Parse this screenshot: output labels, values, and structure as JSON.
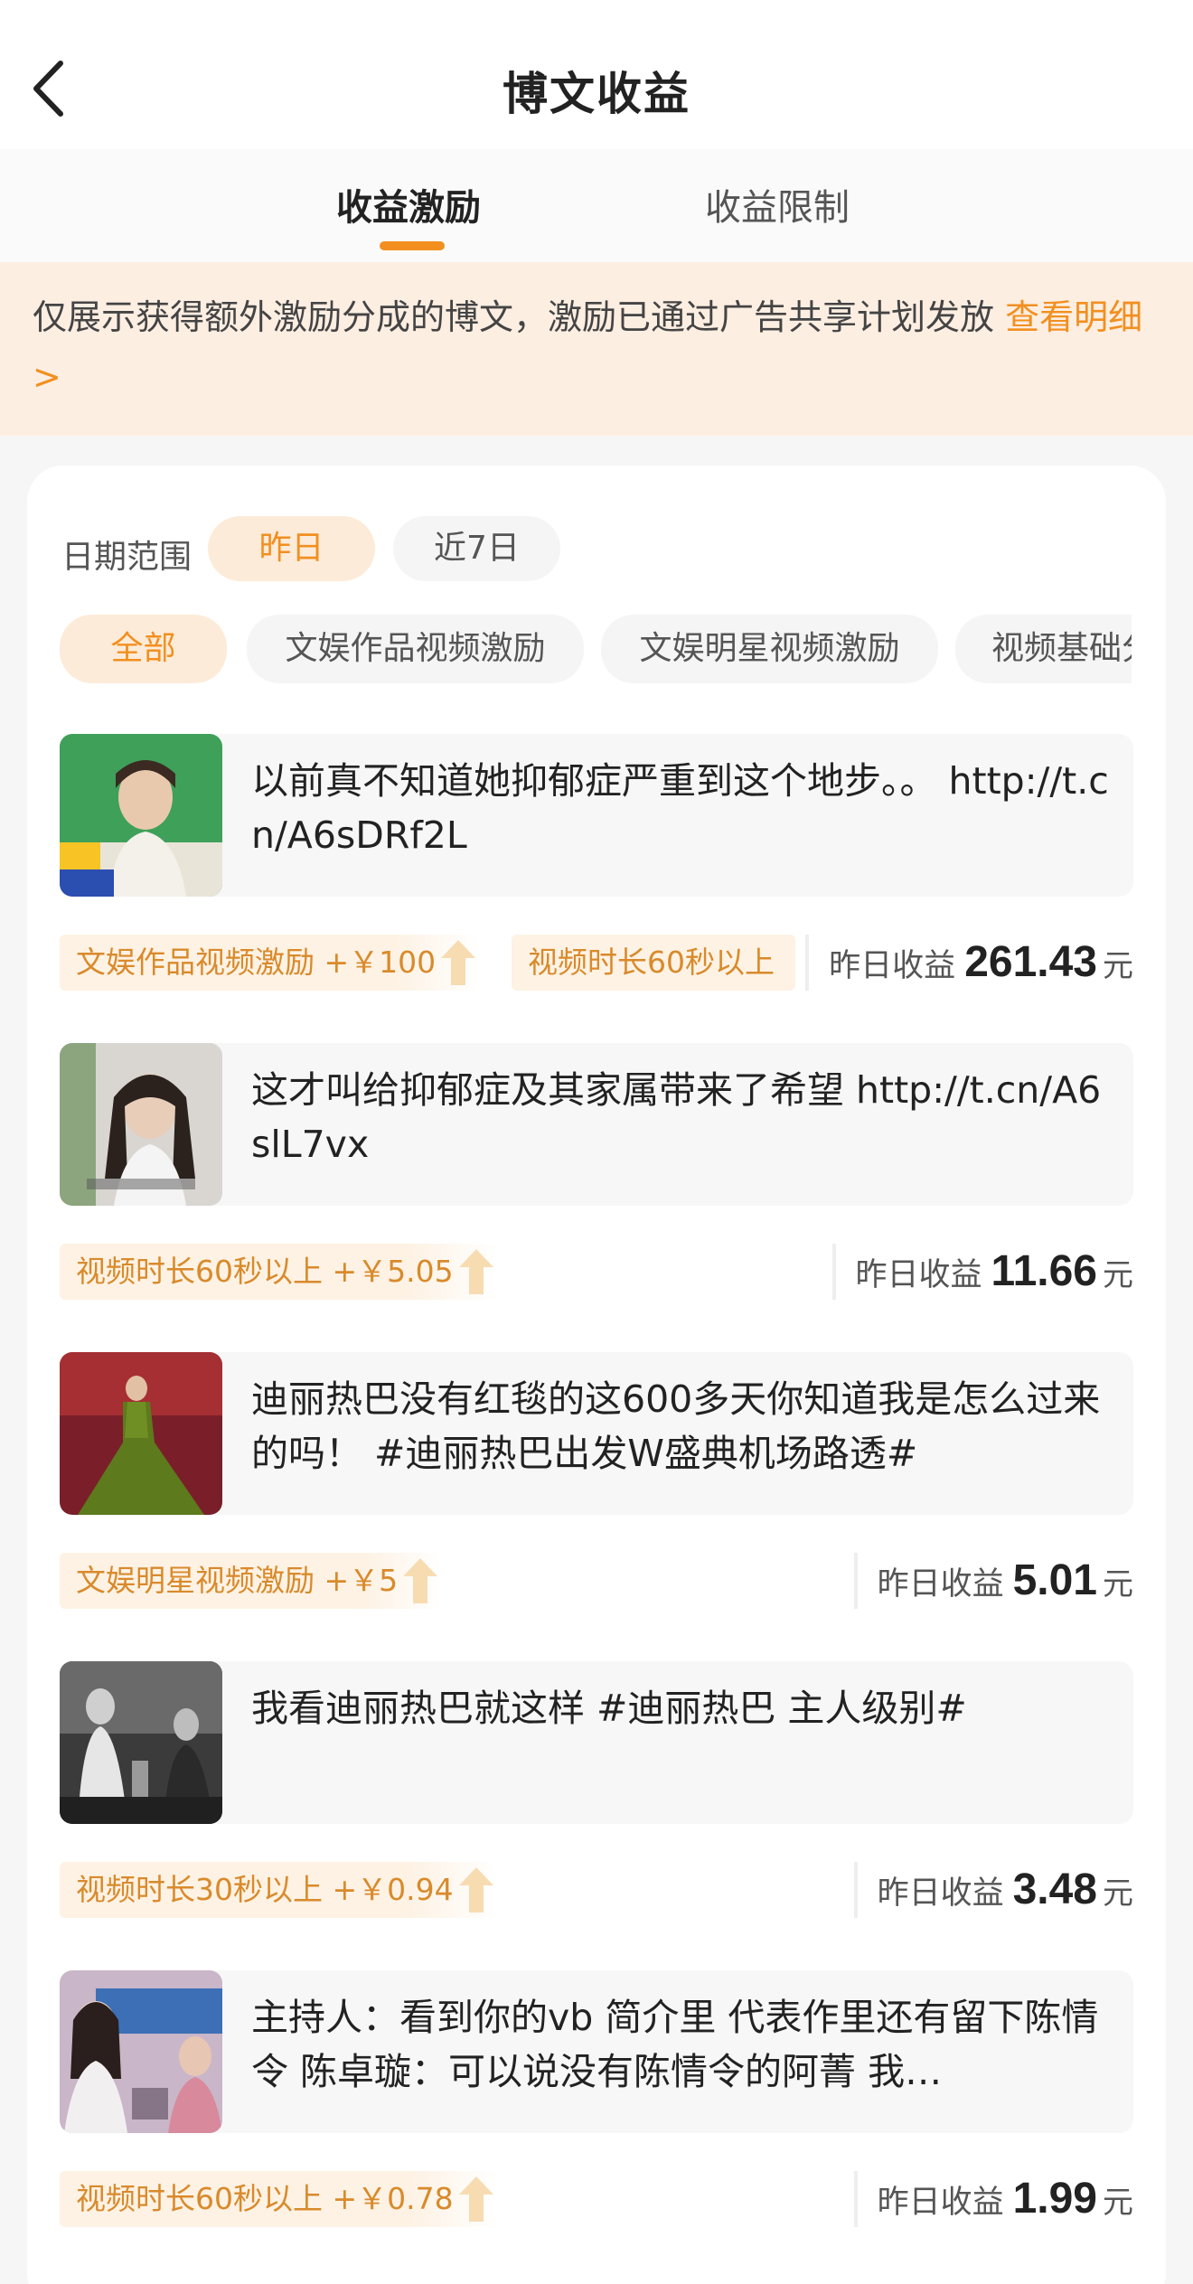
{
  "header": {
    "title": "博文收益"
  },
  "tabs": [
    {
      "label": "收益激励",
      "active": true
    },
    {
      "label": "收益限制",
      "active": false
    }
  ],
  "notice": {
    "text": "仅展示获得额外激励分成的博文，激励已通过广告共享计划发放 ",
    "link": "查看明细>"
  },
  "filters": {
    "date_label": "日期范围",
    "date_options": [
      "昨日",
      "近7日"
    ],
    "categories": [
      "全部",
      "文娱作品视频激励",
      "文娱明星视频激励",
      "视频基础分"
    ]
  },
  "earnings_label": "昨日收益",
  "unit": "元",
  "posts": [
    {
      "text": "以前真不知道她抑郁症严重到这个地步。。 http://t.cn/A6sDRf2L",
      "tags": [
        "文娱作品视频激励 +￥100",
        "视频时长60秒以上"
      ],
      "earnings": "261.43"
    },
    {
      "text": "这才叫给抑郁症及其家属带来了希望 http://t.cn/A6slL7vx",
      "tags": [
        "视频时长60秒以上 +￥5.05"
      ],
      "earnings": "11.66"
    },
    {
      "text": "迪丽热巴没有红毯的这600多天你知道我是怎么过来的吗！ #迪丽热巴出发W盛典机场路透#",
      "tags": [
        "文娱明星视频激励 +￥5"
      ],
      "earnings": "5.01"
    },
    {
      "text": "我看迪丽热巴就这样 #迪丽热巴 主人级别#",
      "tags": [
        "视频时长30秒以上 +￥0.94"
      ],
      "earnings": "3.48"
    },
    {
      "text": "主持人：看到你的vb 简介里 代表作里还有留下陈情令 陈卓璇：可以说没有陈情令的阿菁 我…",
      "tags": [
        "视频时长60秒以上 +￥0.78"
      ],
      "earnings": "1.99"
    }
  ],
  "colors": {
    "accent": "#f28f1f",
    "notice_bg": "#fdeee2",
    "tag_text": "#d98a2b"
  }
}
